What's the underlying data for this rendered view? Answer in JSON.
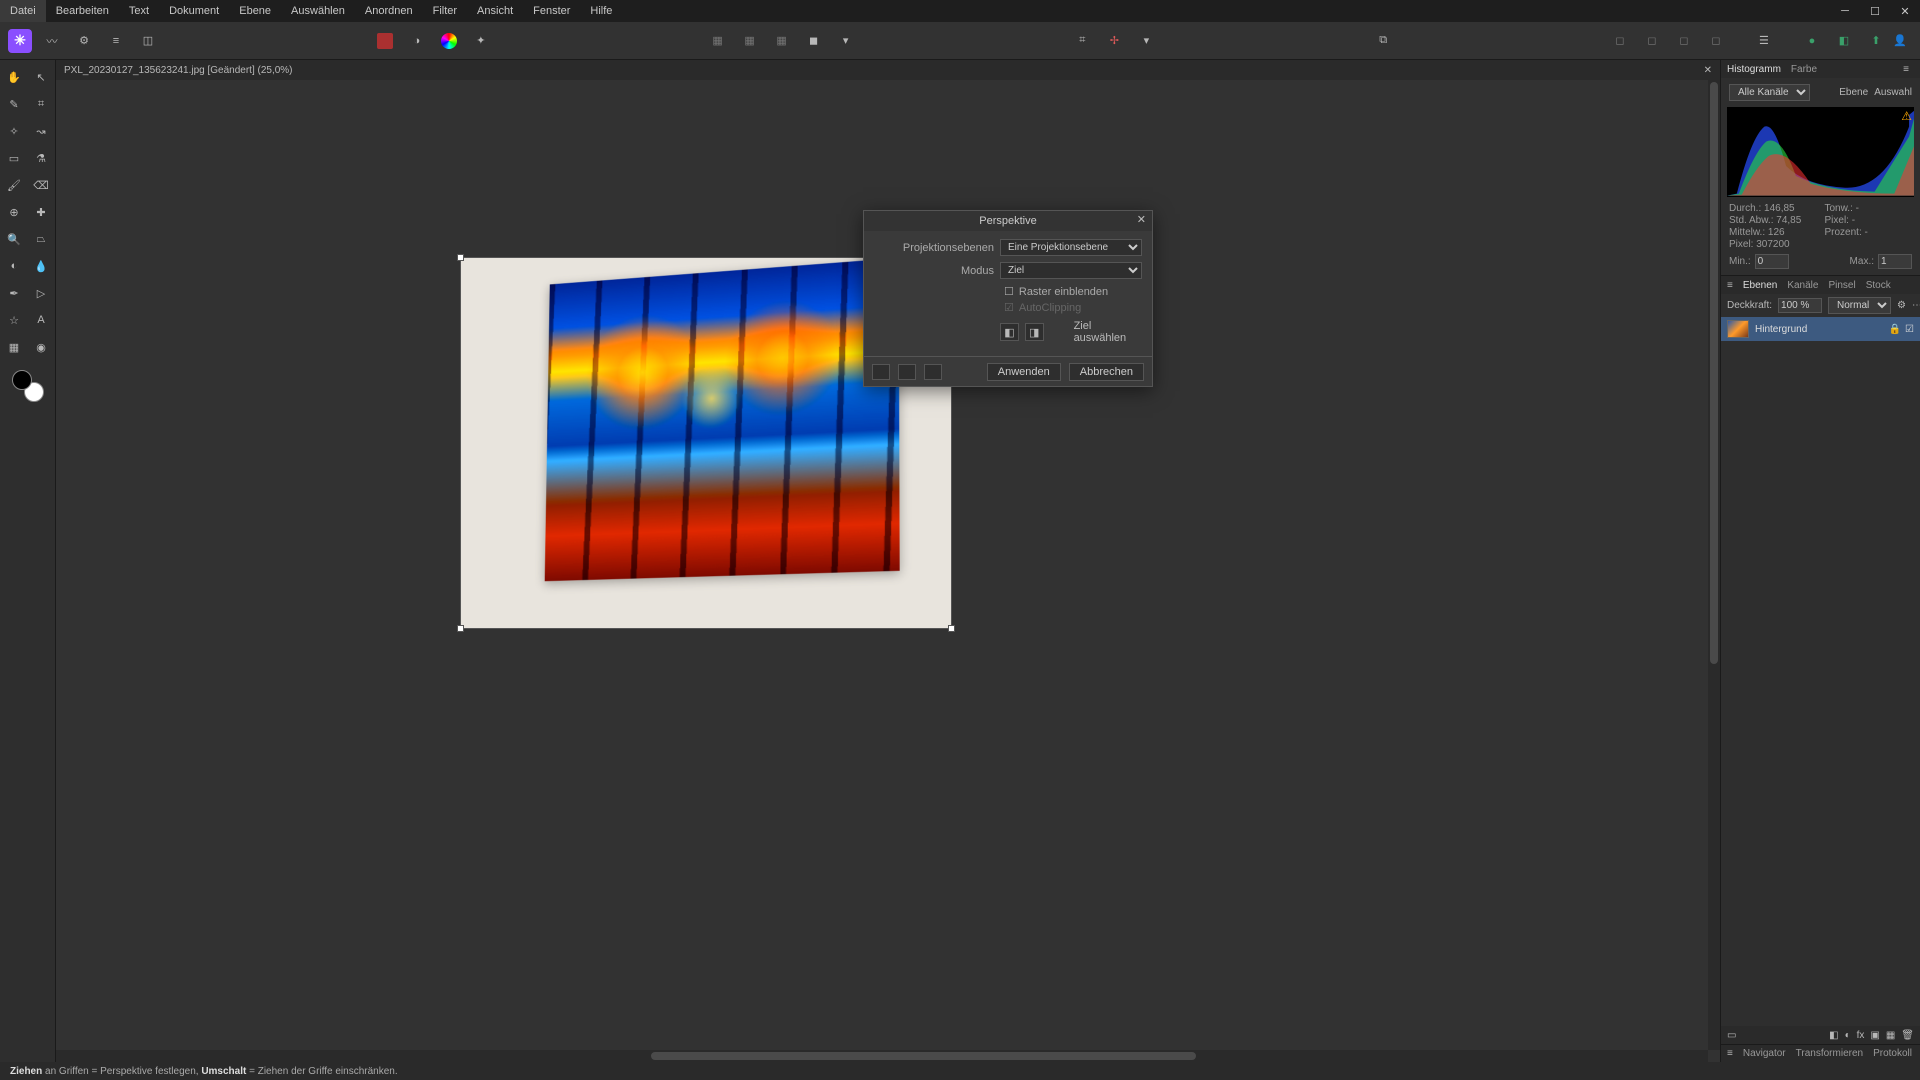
{
  "menu": [
    "Datei",
    "Bearbeiten",
    "Text",
    "Dokument",
    "Ebene",
    "Auswählen",
    "Anordnen",
    "Filter",
    "Ansicht",
    "Fenster",
    "Hilfe"
  ],
  "document": {
    "tab_title": "PXL_20230127_135623241.jpg [Geändert] (25,0%)"
  },
  "dialog": {
    "title": "Perspektive",
    "planes_label": "Projektionsebenen",
    "planes_value": "Eine Projektionsebene",
    "mode_label": "Modus",
    "mode_value": "Ziel",
    "show_grid": "Raster einblenden",
    "autoclipping": "AutoClipping",
    "select_target": "Ziel auswählen",
    "apply": "Anwenden",
    "cancel": "Abbrechen"
  },
  "histogram": {
    "tabs": [
      "Histogramm",
      "Farbe"
    ],
    "channels": "Alle Kanäle",
    "toggle1": "Ebene",
    "toggle2": "Auswahl",
    "stats": {
      "durch_lbl": "Durch.:",
      "durch": "146,85",
      "tonw_lbl": "Tonw.:",
      "tonw": "-",
      "std_lbl": "Std. Abw.:",
      "std": "74,85",
      "pixel2_lbl": "Pixel:",
      "pixel2": "-",
      "mittelw_lbl": "Mittelw.:",
      "mittelw": "126",
      "proz_lbl": "Prozent:",
      "proz": "-",
      "pixel_lbl": "Pixel:",
      "pixel": "307200"
    },
    "min_lbl": "Min.:",
    "min_val": "0",
    "max_lbl": "Max.:",
    "max_val": "1"
  },
  "layers": {
    "tabs": [
      "Ebenen",
      "Kanäle",
      "Pinsel",
      "Stock"
    ],
    "opacity_lbl": "Deckkraft:",
    "opacity_val": "100 %",
    "blend": "Normal",
    "layer_name": "Hintergrund"
  },
  "bottom_tabs": [
    "Navigator",
    "Transformieren",
    "Protokoll"
  ],
  "status": {
    "ziehen": "Ziehen",
    "mid": " an Griffen = Perspektive festlegen, ",
    "umschalt": "Umschalt",
    "tail": " = Ziehen der Griffe einschränken."
  }
}
